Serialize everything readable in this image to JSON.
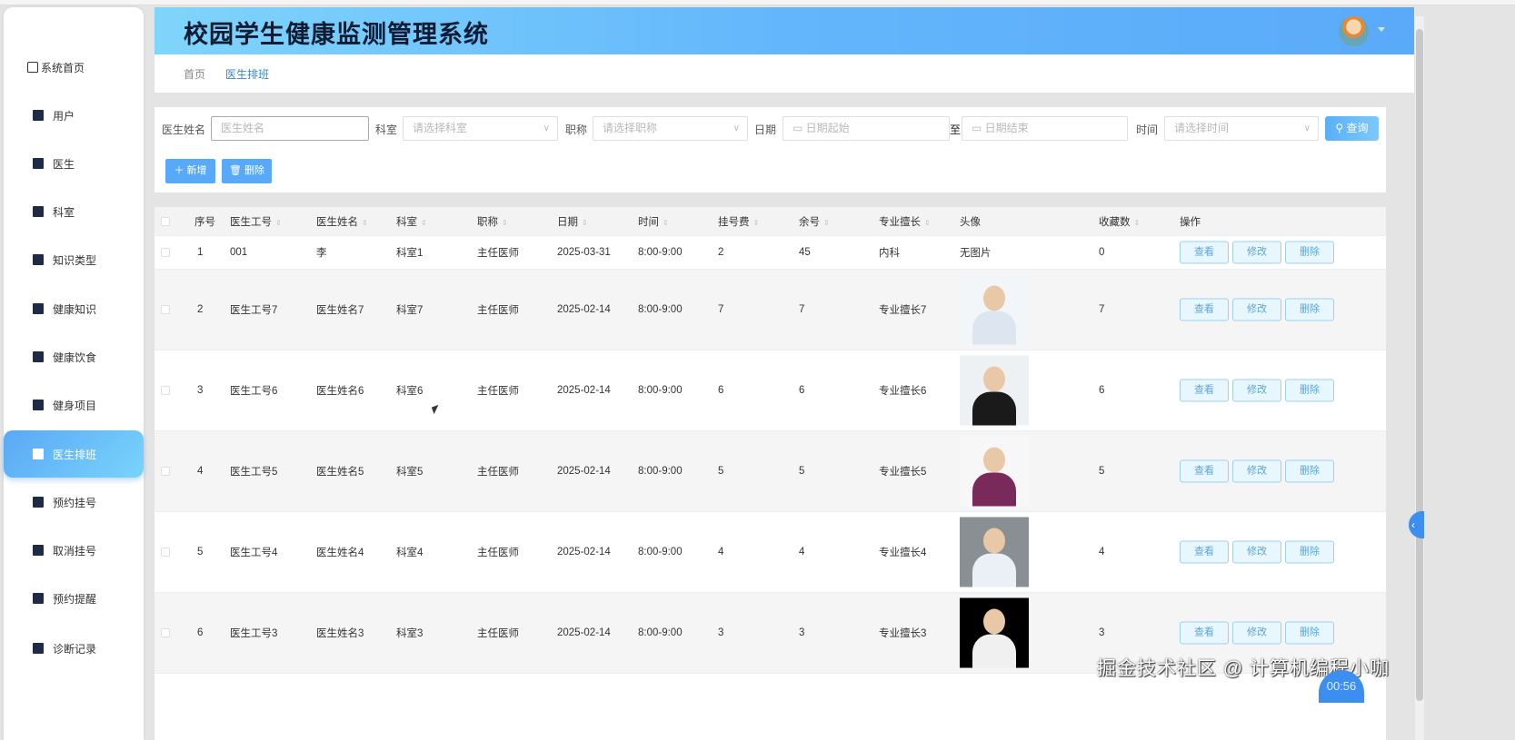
{
  "app": {
    "title": "校园学生健康监测管理系统"
  },
  "sidebar": {
    "items": [
      {
        "label": "系统首页",
        "icon": "home-icon"
      },
      {
        "label": "用户",
        "icon": "clipboard-check-icon"
      },
      {
        "label": "医生",
        "icon": "grid-icon"
      },
      {
        "label": "科室",
        "icon": "user-icon"
      },
      {
        "label": "知识类型",
        "icon": "ticket-icon"
      },
      {
        "label": "健康知识",
        "icon": "chart-icon"
      },
      {
        "label": "健康饮食",
        "icon": "apps-icon"
      },
      {
        "label": "健身项目",
        "icon": "apps-icon"
      },
      {
        "label": "医生排班",
        "icon": "briefcase-icon",
        "active": true
      },
      {
        "label": "预约挂号",
        "icon": "apps-icon"
      },
      {
        "label": "取消挂号",
        "icon": "apps-icon"
      },
      {
        "label": "预约提醒",
        "icon": "books-icon"
      },
      {
        "label": "诊断记录",
        "icon": "brush-icon"
      }
    ]
  },
  "breadcrumb": {
    "home": "首页",
    "current": "医生排班"
  },
  "search": {
    "name_label": "医生姓名",
    "name_placeholder": "医生姓名",
    "dept_label": "科室",
    "dept_placeholder": "请选择科室",
    "title_label": "职称",
    "title_placeholder": "请选择职称",
    "date_label": "日期",
    "date_start": "日期起始",
    "date_sep": "至",
    "date_end": "日期结束",
    "time_label": "时间",
    "time_placeholder": "请选择时间",
    "query": "查询"
  },
  "toolbar": {
    "add": "新增",
    "delete": "删除"
  },
  "table": {
    "headers": [
      "序号",
      "医生工号",
      "医生姓名",
      "科室",
      "职称",
      "日期",
      "时间",
      "挂号费",
      "余号",
      "专业擅长",
      "头像",
      "收藏数",
      "操作"
    ],
    "actions": {
      "view": "查看",
      "edit": "修改",
      "delete": "删除"
    },
    "rows": [
      {
        "no": "1",
        "id": "001",
        "name": "李",
        "dept": "科室1",
        "title": "主任医师",
        "date": "2025-03-31",
        "time": "8:00-9:00",
        "fee": "2",
        "left": "45",
        "specialty": "内科",
        "photo": "无图片",
        "fav": "0"
      },
      {
        "no": "2",
        "id": "医生工号7",
        "name": "医生姓名7",
        "dept": "科室7",
        "title": "主任医师",
        "date": "2025-02-14",
        "time": "8:00-9:00",
        "fee": "7",
        "left": "7",
        "specialty": "专业擅长7",
        "fav": "7"
      },
      {
        "no": "3",
        "id": "医生工号6",
        "name": "医生姓名6",
        "dept": "科室6",
        "title": "主任医师",
        "date": "2025-02-14",
        "time": "8:00-9:00",
        "fee": "6",
        "left": "6",
        "specialty": "专业擅长6",
        "fav": "6"
      },
      {
        "no": "4",
        "id": "医生工号5",
        "name": "医生姓名5",
        "dept": "科室5",
        "title": "主任医师",
        "date": "2025-02-14",
        "time": "8:00-9:00",
        "fee": "5",
        "left": "5",
        "specialty": "专业擅长5",
        "fav": "5"
      },
      {
        "no": "5",
        "id": "医生工号4",
        "name": "医生姓名4",
        "dept": "科室4",
        "title": "主任医师",
        "date": "2025-02-14",
        "time": "8:00-9:00",
        "fee": "4",
        "left": "4",
        "specialty": "专业擅长4",
        "fav": "4"
      },
      {
        "no": "6",
        "id": "医生工号3",
        "name": "医生姓名3",
        "dept": "科室3",
        "title": "主任医师",
        "date": "2025-02-14",
        "time": "8:00-9:00",
        "fee": "3",
        "left": "3",
        "specialty": "专业擅长3",
        "fav": "3"
      }
    ]
  },
  "overlay": {
    "watermark": "掘金技术社区 @ 计算机编程小咖",
    "timer": "00:56"
  }
}
